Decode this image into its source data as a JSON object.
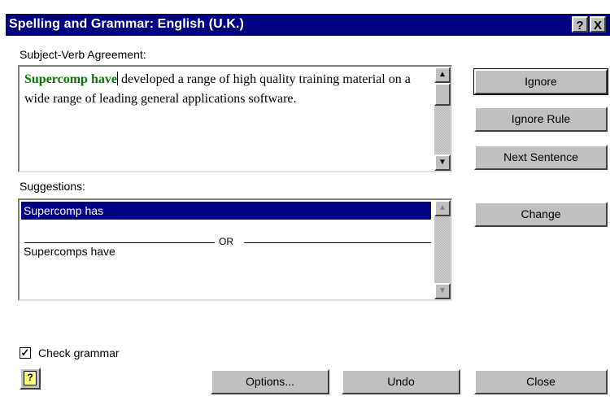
{
  "window": {
    "title": "Spelling and Grammar: English (U.K.)",
    "help_glyph": "?",
    "close_glyph": "X"
  },
  "issue": {
    "label": "Subject-Verb Agreement:",
    "highlight": "Supercomp have",
    "rest": " developed a range of high quality training material on a wide range of leading general applications software."
  },
  "suggestions": {
    "label": "Suggestions:",
    "items": [
      "Supercomp has",
      "Supercomps have"
    ],
    "separator": "OR"
  },
  "buttons": {
    "ignore": "Ignore",
    "ignore_rule": "Ignore Rule",
    "next_sentence": "Next Sentence",
    "change": "Change",
    "options": "Options...",
    "undo": "Undo",
    "close": "Close"
  },
  "check_grammar": {
    "label": "Check grammar",
    "checked": true
  },
  "icons": {
    "help_button": "help-icon"
  }
}
